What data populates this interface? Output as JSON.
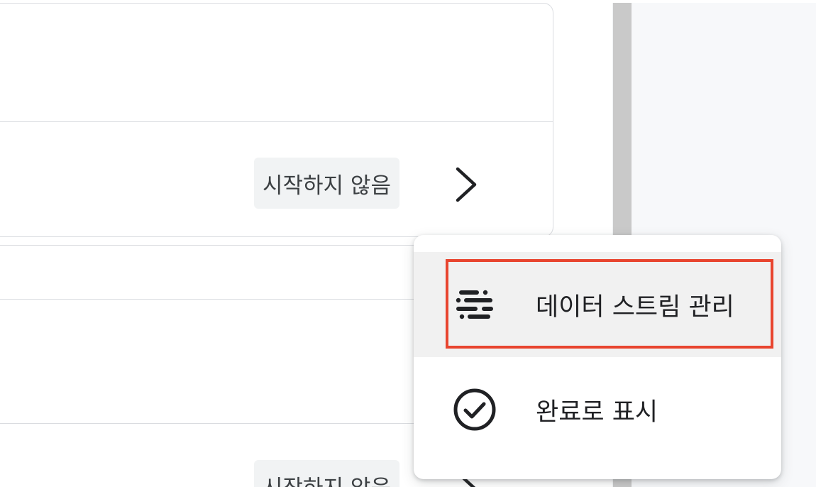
{
  "card": {
    "row1_status": "시작하지 않음"
  },
  "list": {
    "row_status": "시작하지 않음"
  },
  "context_menu": {
    "items": [
      {
        "icon": "data-stream-icon",
        "label": "데이터 스트림 관리"
      },
      {
        "icon": "check-circle-icon",
        "label": "완료로 표시"
      }
    ]
  },
  "colors": {
    "highlight": "#e8452f",
    "hover_bg": "#f1f1f1",
    "chip_bg": "#f1f3f4",
    "scroll_thumb": "#c9c9c9"
  }
}
